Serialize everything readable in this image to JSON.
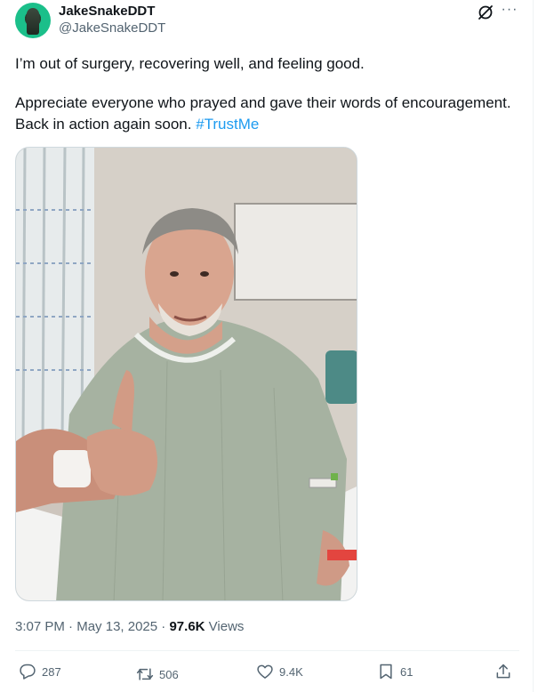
{
  "author": {
    "display_name": "JakeSnakeDDT",
    "handle": "@JakeSnakeDDT"
  },
  "tweet": {
    "line1": "I’m out of surgery, recovering well, and feeling good.",
    "line2_text": "Appreciate everyone who prayed and gave their words of encouragement. Back in action again soon. ",
    "hashtag": "#TrustMe"
  },
  "meta": {
    "time": "3:07 PM",
    "separator1": " · ",
    "date": "May 13, 2025",
    "separator2": " · ",
    "views_count": "97.6K",
    "views_label": " Views"
  },
  "actions": {
    "replies": "287",
    "reposts": "506",
    "likes": "9.4K",
    "bookmarks": "61"
  },
  "icons": {
    "header": [
      "grok-icon",
      "more-icon"
    ],
    "actions": [
      "reply-icon",
      "repost-icon",
      "like-icon",
      "bookmark-icon",
      "share-icon"
    ]
  },
  "colors": {
    "accent": "#1d9bf0",
    "text": "#0f1419",
    "secondary": "#536471"
  }
}
